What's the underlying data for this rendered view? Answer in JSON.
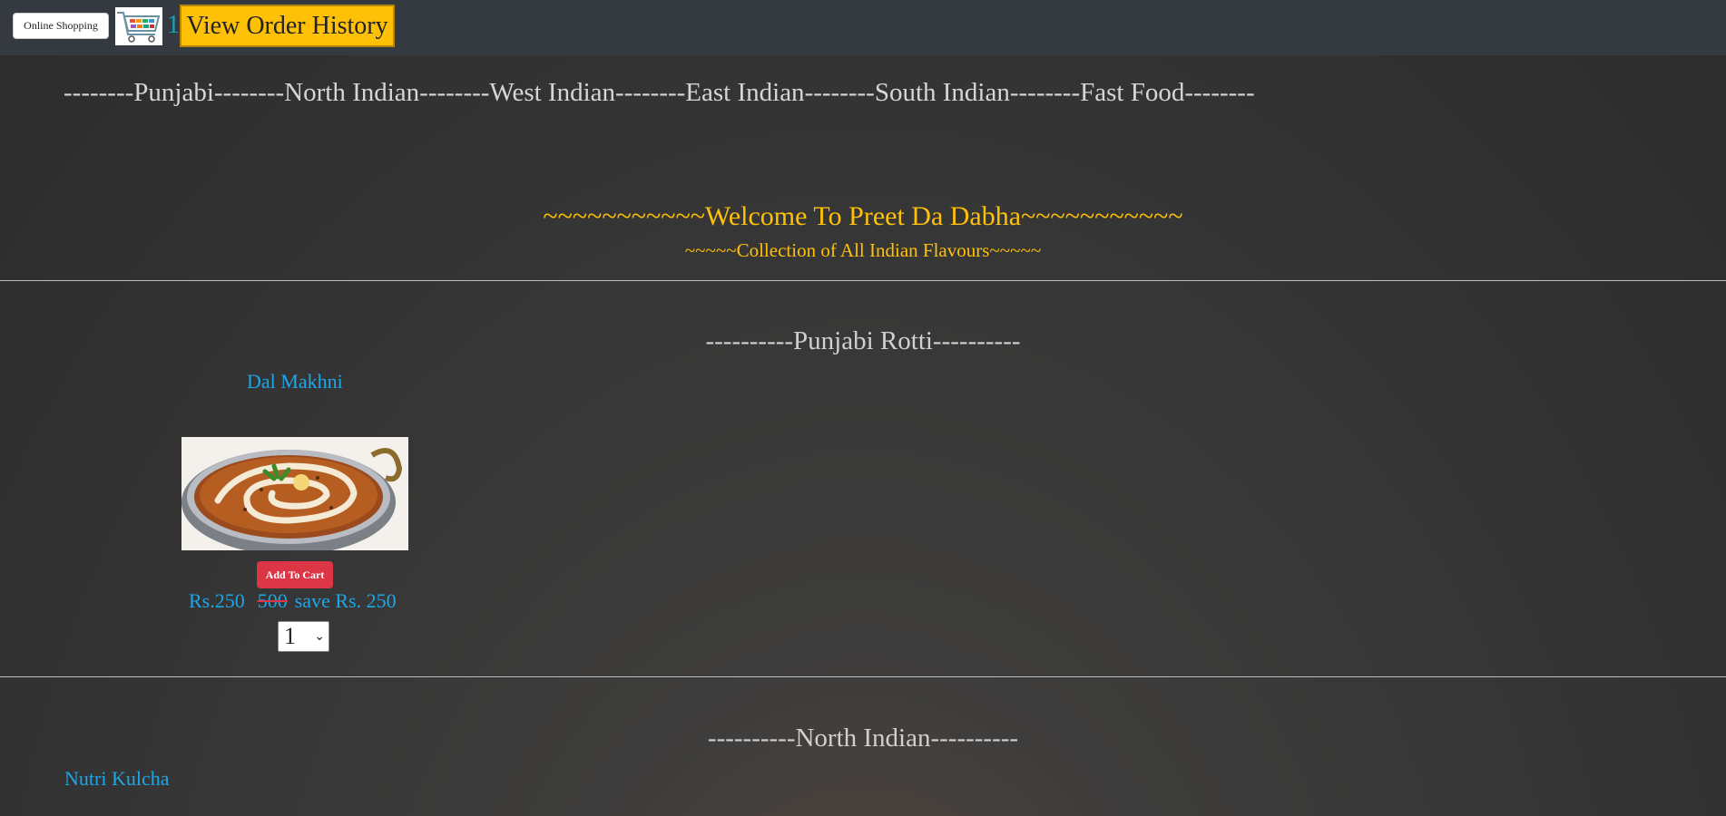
{
  "topbar": {
    "brand_label": "Online Shopping",
    "cart_icon": "shopping-cart-icon",
    "cart_count": "1",
    "order_history_label": "View Order History"
  },
  "categories": {
    "separator": "--------",
    "items": [
      "Punjabi",
      "North Indian",
      "West Indian",
      "East Indian",
      "South Indian",
      "Fast Food"
    ]
  },
  "hero": {
    "welcome": "~~~~~~~~~~~Welcome To Preet Da Dabha~~~~~~~~~~~",
    "tagline": "~~~~~Collection of All Indian Flavours~~~~~"
  },
  "sections": [
    {
      "title": "----------Punjabi Rotti----------",
      "items": [
        {
          "name": "Dal Makhni",
          "image_icon": "dal-makhni-image",
          "add_to_cart_label": "Add To Cart",
          "price": "Rs.250",
          "old_price": "500",
          "save_text": "save Rs. 250",
          "quantity": "1"
        }
      ]
    },
    {
      "title": "----------North Indian----------",
      "items": [
        {
          "name": "Nutri Kulcha"
        }
      ]
    }
  ],
  "colors": {
    "topbar": "#343a40",
    "accent_yellow": "#ffc107",
    "link_blue": "#1ea7e8",
    "danger_red": "#dc3545"
  }
}
